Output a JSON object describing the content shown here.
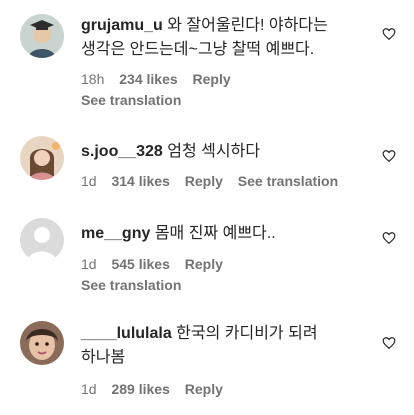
{
  "comments": [
    {
      "username": "grujamu_u",
      "text_line1": "와 잘어울린다! 야하다는",
      "text_line2": "생각은 안드는데~그냥 찰떡 예쁘다.",
      "time": "18h",
      "likes": "234 likes",
      "reply": "Reply",
      "see_translation": "See translation",
      "avatar_icon": "graduate-avatar"
    },
    {
      "username": "s.joo__328",
      "text": "엄청 섹시하다",
      "time": "1d",
      "likes": "314 likes",
      "reply": "Reply",
      "see_translation": "See translation",
      "avatar_icon": "woman-avatar"
    },
    {
      "username": "me__gny",
      "text": "몸매 진짜 예쁘다..",
      "time": "1d",
      "likes": "545 likes",
      "reply": "Reply",
      "see_translation": "See translation",
      "avatar_icon": "default-avatar"
    },
    {
      "username": "____lululala",
      "text_line1": "한국의 카디비가 되려",
      "text_line2": "하나봄",
      "time": "1d",
      "likes": "289 likes",
      "reply": "Reply",
      "avatar_icon": "face-avatar"
    }
  ],
  "icons": {
    "like": "heart-icon"
  }
}
